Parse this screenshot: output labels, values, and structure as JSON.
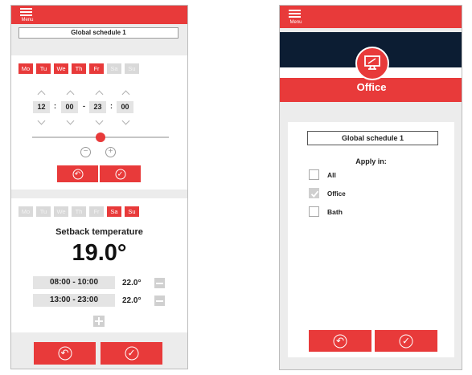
{
  "left": {
    "menu_label": "Menu",
    "schedule_name": "Global schedule 1",
    "week_on": [
      "Mo",
      "Tu",
      "We",
      "Th",
      "Fr",
      "Sa",
      "Su"
    ],
    "time": {
      "start_hour": "12",
      "start_min": "00",
      "end_hour": "23",
      "end_min": "00",
      "colon": ":",
      "dash": "-"
    },
    "slider_level": 0.5,
    "zoom_out_symbol": "−",
    "zoom_in_symbol": "+",
    "week_setback": [
      "Mo",
      "Tu",
      "We",
      "Th",
      "Fr",
      "Sa",
      "Su"
    ],
    "setback_title": "Setback temperature",
    "setback_value": "19.0°",
    "ranges": [
      {
        "label": "08:00 - 10:00",
        "temp": "22.0°"
      },
      {
        "label": "13:00 - 23:00",
        "temp": "22.0°"
      }
    ]
  },
  "right": {
    "menu_label": "Menu",
    "zone_title": "Office",
    "schedule_name": "Global schedule 1",
    "apply_in_label": "Apply in:",
    "options": [
      {
        "label": "All",
        "checked": false
      },
      {
        "label": "Office",
        "checked": true
      },
      {
        "label": "Bath",
        "checked": false
      }
    ]
  },
  "colors": {
    "accent": "#e83a3a",
    "navy": "#0c1d33",
    "inactive_day": "#d9d9d9"
  },
  "icons": [
    "menu-icon",
    "back-icon",
    "confirm-icon",
    "monitor-icon",
    "zoom-out-icon",
    "zoom-in-icon",
    "minus-icon",
    "plus-icon"
  ]
}
